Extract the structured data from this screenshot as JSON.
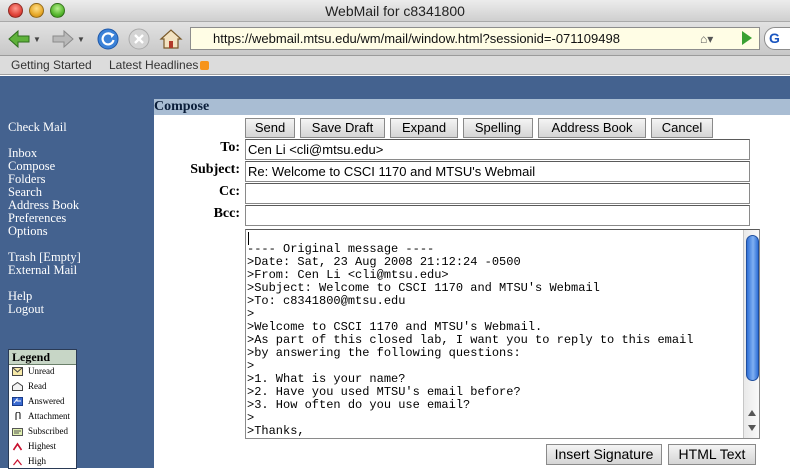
{
  "window": {
    "title": "WebMail for c8341800"
  },
  "browser": {
    "url": "https://webmail.mtsu.edu/wm/mail/window.html?sessionid=-071109498",
    "search_label": "G",
    "bookmarks": [
      "Getting Started",
      "Latest Headlines"
    ]
  },
  "sidebar": {
    "group1": [
      "Check Mail"
    ],
    "group2": [
      "Inbox",
      "Compose",
      "Folders",
      "Search",
      "Address Book",
      "Preferences",
      "Options"
    ],
    "group3": [
      "Trash  [Empty]",
      "External Mail"
    ],
    "group4": [
      "Help",
      "Logout"
    ]
  },
  "legend": {
    "title": "Legend",
    "items": [
      "Unread",
      "Read",
      "Answered",
      "Attachment",
      "Subscribed",
      "Highest",
      "High"
    ]
  },
  "compose": {
    "header": "Compose",
    "buttons": [
      "Send",
      "Save Draft",
      "Expand",
      "Spelling",
      "Address Book",
      "Cancel"
    ],
    "labels": {
      "to": "To:",
      "subject": "Subject:",
      "cc": "Cc:",
      "bcc": "Bcc:"
    },
    "to": "Cen Li <cli@mtsu.edu>",
    "subject": "Re: Welcome to CSCI 1170 and MTSU's Webmail",
    "cc": "",
    "bcc": "",
    "body": "\n---- Original message ----\n>Date: Sat, 23 Aug 2008 21:12:24 -0500\n>From: Cen Li <cli@mtsu.edu>\n>Subject: Welcome to CSCI 1170 and MTSU's Webmail\n>To: c8341800@mtsu.edu\n>\n>Welcome to CSCI 1170 and MTSU's Webmail.\n>As part of this closed lab, I want you to reply to this email\n>by answering the following questions:\n>\n>1. What is your name?\n>2. Have you used MTSU's email before?\n>3. How often do you use email?\n>\n>Thanks,",
    "bottom_buttons": [
      "Insert Signature",
      "HTML Text"
    ]
  }
}
